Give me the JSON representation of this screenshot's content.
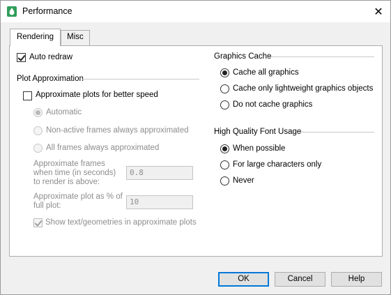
{
  "window": {
    "title": "Performance",
    "close_label": "✕"
  },
  "tabs": {
    "rendering": "Rendering",
    "misc": "Misc"
  },
  "auto_redraw": {
    "label": "Auto redraw",
    "checked": true
  },
  "plot_approx": {
    "heading": "Plot Approximation",
    "approximate": {
      "label": "Approximate plots for better speed",
      "checked": false
    },
    "modes": [
      {
        "label": "Automatic",
        "selected": true
      },
      {
        "label": "Non-active frames always approximated",
        "selected": false
      },
      {
        "label": "All frames always approximated",
        "selected": false
      }
    ],
    "time_label": "Approximate frames when time (in seconds) to render is above:",
    "time_value": "0.8",
    "percent_label": "Approximate plot as % of full plot:",
    "percent_value": "10",
    "show_text": {
      "label": "Show text/geometries in approximate plots",
      "checked": true
    }
  },
  "graphics_cache": {
    "heading": "Graphics Cache",
    "options": [
      {
        "label": "Cache all graphics",
        "selected": true
      },
      {
        "label": "Cache only lightweight graphics objects",
        "selected": false
      },
      {
        "label": "Do not cache graphics",
        "selected": false
      }
    ]
  },
  "font_usage": {
    "heading": "High Quality Font Usage",
    "options": [
      {
        "label": "When possible",
        "selected": true
      },
      {
        "label": "For large characters only",
        "selected": false
      },
      {
        "label": "Never",
        "selected": false
      }
    ]
  },
  "buttons": {
    "ok": "OK",
    "cancel": "Cancel",
    "help": "Help"
  },
  "colors": {
    "accent": "#0078d7",
    "icon_green": "#2f9e5a"
  }
}
